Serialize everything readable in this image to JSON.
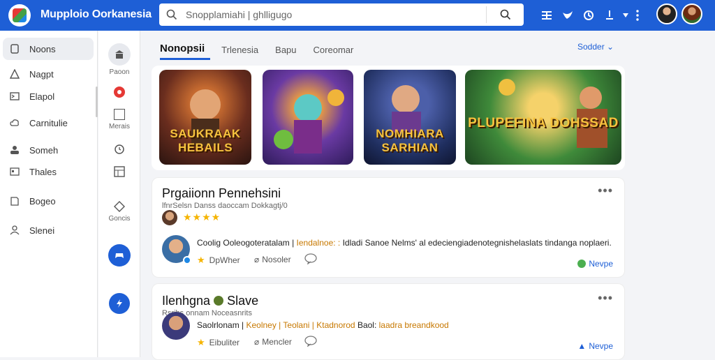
{
  "app": {
    "title": "Mupploio Oorkanesia"
  },
  "search": {
    "placeholder": "Snopplamiahi | ghlligugo"
  },
  "topbar_icons": [
    "grid-icon",
    "bird-icon",
    "history-icon",
    "user-icon",
    "menu-icon"
  ],
  "sidebar": {
    "items": [
      {
        "label": "Noons",
        "icon": "home-icon",
        "active": true
      },
      {
        "label": "Nagpt",
        "icon": "alert-icon",
        "active": false
      },
      {
        "label": "Elapol",
        "icon": "message-icon",
        "active": false
      },
      {
        "label": "Carnitulie",
        "icon": "cloud-icon",
        "active": false
      },
      {
        "label": "Someh",
        "icon": "group-icon",
        "active": false
      },
      {
        "label": "Thales",
        "icon": "store-icon",
        "active": false
      },
      {
        "label": "Bogeo",
        "icon": "book-icon",
        "active": false
      },
      {
        "label": "Slenei",
        "icon": "person-icon",
        "active": false
      }
    ]
  },
  "rail": {
    "items": [
      {
        "label": "Paoon",
        "icon": "building-icon"
      },
      {
        "label": "",
        "icon": "record-icon"
      },
      {
        "label": "Merais",
        "icon": "square-icon"
      },
      {
        "label": "",
        "icon": "clock-icon"
      },
      {
        "label": "",
        "icon": "grid-box-icon"
      },
      {
        "label": "Goncis",
        "icon": "diamond-icon"
      },
      {
        "label": "",
        "icon": "controller-icon"
      },
      {
        "label": "",
        "icon": "bolt-icon"
      }
    ]
  },
  "tabs": [
    {
      "label": "Nonopsii",
      "active": true
    },
    {
      "label": "Trlenesia",
      "active": false
    },
    {
      "label": "Bapu",
      "active": false
    },
    {
      "label": "Coreomar",
      "active": false
    }
  ],
  "sort": {
    "label": "Sodder"
  },
  "games": [
    {
      "title": "SAUKRAAK HEBAILS",
      "bg": "#6a2d1e"
    },
    {
      "title": "",
      "bg": "#3a2a7a"
    },
    {
      "title": "NOMHIARA SARHIAN",
      "bg": "#1f2e5e"
    },
    {
      "title": "PLUPEFINA DOHSSAD",
      "bg": "#2e6a2e"
    }
  ],
  "posts": [
    {
      "title": "Prgaiionn Pennehsini",
      "meta": "lfnrSelsn Danss daoccam Dokkagtj/0",
      "rating": 4,
      "text_prefix": "Coolig Ooleogoteratalam | ",
      "text_highlight": "Iendalnoe: :",
      "text_suffix": " Idladi Sanoe Nelms' al edeciengiadenotegnishelaslats tindanga noplaeri.",
      "like": "DpWher",
      "comment": "Nosoler",
      "link": "Nevpe"
    },
    {
      "title": "Ilenhgna",
      "title_suffix": "Slave",
      "meta": "Rsribs onnam Noceasnrits",
      "text_prefix": "Saolrlonam | ",
      "text_highlight": "Keolney | Teolani | Ktadnorod",
      "text_suffix": " Baol: ",
      "text_highlight2": "laadra breandkood",
      "like": "Eibuliter",
      "comment": "Mencler",
      "link": "Nevpe"
    }
  ],
  "colors": {
    "brand": "#1e5fd6",
    "star": "#f5b400",
    "highlight": "#c77800"
  }
}
